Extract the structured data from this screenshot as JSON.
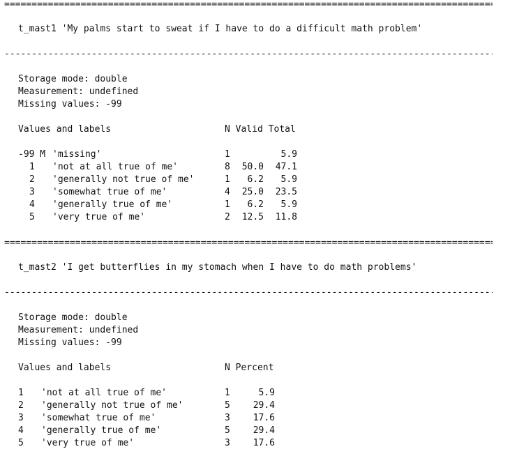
{
  "sections": [
    {
      "sep_top": "====================================================================================================",
      "header": "t_mast1 'My palms start to sweat if I have to do a difficult math problem'",
      "sep_mid": "----------------------------------------------------------------------------------------------------",
      "storage": "Storage mode: double",
      "measurement": "Measurement: undefined",
      "missing": "Missing values: -99",
      "col_values": "Values and labels",
      "col_stats": "N Valid Total",
      "rows": [
        {
          "code": "-99 M",
          "label": "'missing'",
          "n": "1",
          "valid": "",
          "total": "5.9"
        },
        {
          "code": "1",
          "label": "'not at all true of me'",
          "n": "8",
          "valid": "50.0",
          "total": "47.1"
        },
        {
          "code": "2",
          "label": "'generally not true of me'",
          "n": "1",
          "valid": "6.2",
          "total": "5.9"
        },
        {
          "code": "3",
          "label": "'somewhat true of me'",
          "n": "4",
          "valid": "25.0",
          "total": "23.5"
        },
        {
          "code": "4",
          "label": "'generally true of me'",
          "n": "1",
          "valid": "6.2",
          "total": "5.9"
        },
        {
          "code": "5",
          "label": "'very true of me'",
          "n": "2",
          "valid": "12.5",
          "total": "11.8"
        }
      ]
    },
    {
      "sep_top": "====================================================================================================",
      "header": "t_mast2 'I get butterflies in my stomach when I have to do math problems'",
      "sep_mid": "----------------------------------------------------------------------------------------------------",
      "storage": "Storage mode: double",
      "measurement": "Measurement: undefined",
      "missing": "Missing values: -99",
      "col_values": "Values and labels",
      "col_stats": "N Percent",
      "rows": [
        {
          "code": "1",
          "label": "'not at all true of me'",
          "n": "1",
          "percent": "5.9"
        },
        {
          "code": "2",
          "label": "'generally not true of me'",
          "n": "5",
          "percent": "29.4"
        },
        {
          "code": "3",
          "label": "'somewhat true of me'",
          "n": "3",
          "percent": "17.6"
        },
        {
          "code": "4",
          "label": "'generally true of me'",
          "n": "5",
          "percent": "29.4"
        },
        {
          "code": "5",
          "label": "'very true of me'",
          "n": "3",
          "percent": "17.6"
        }
      ]
    }
  ]
}
